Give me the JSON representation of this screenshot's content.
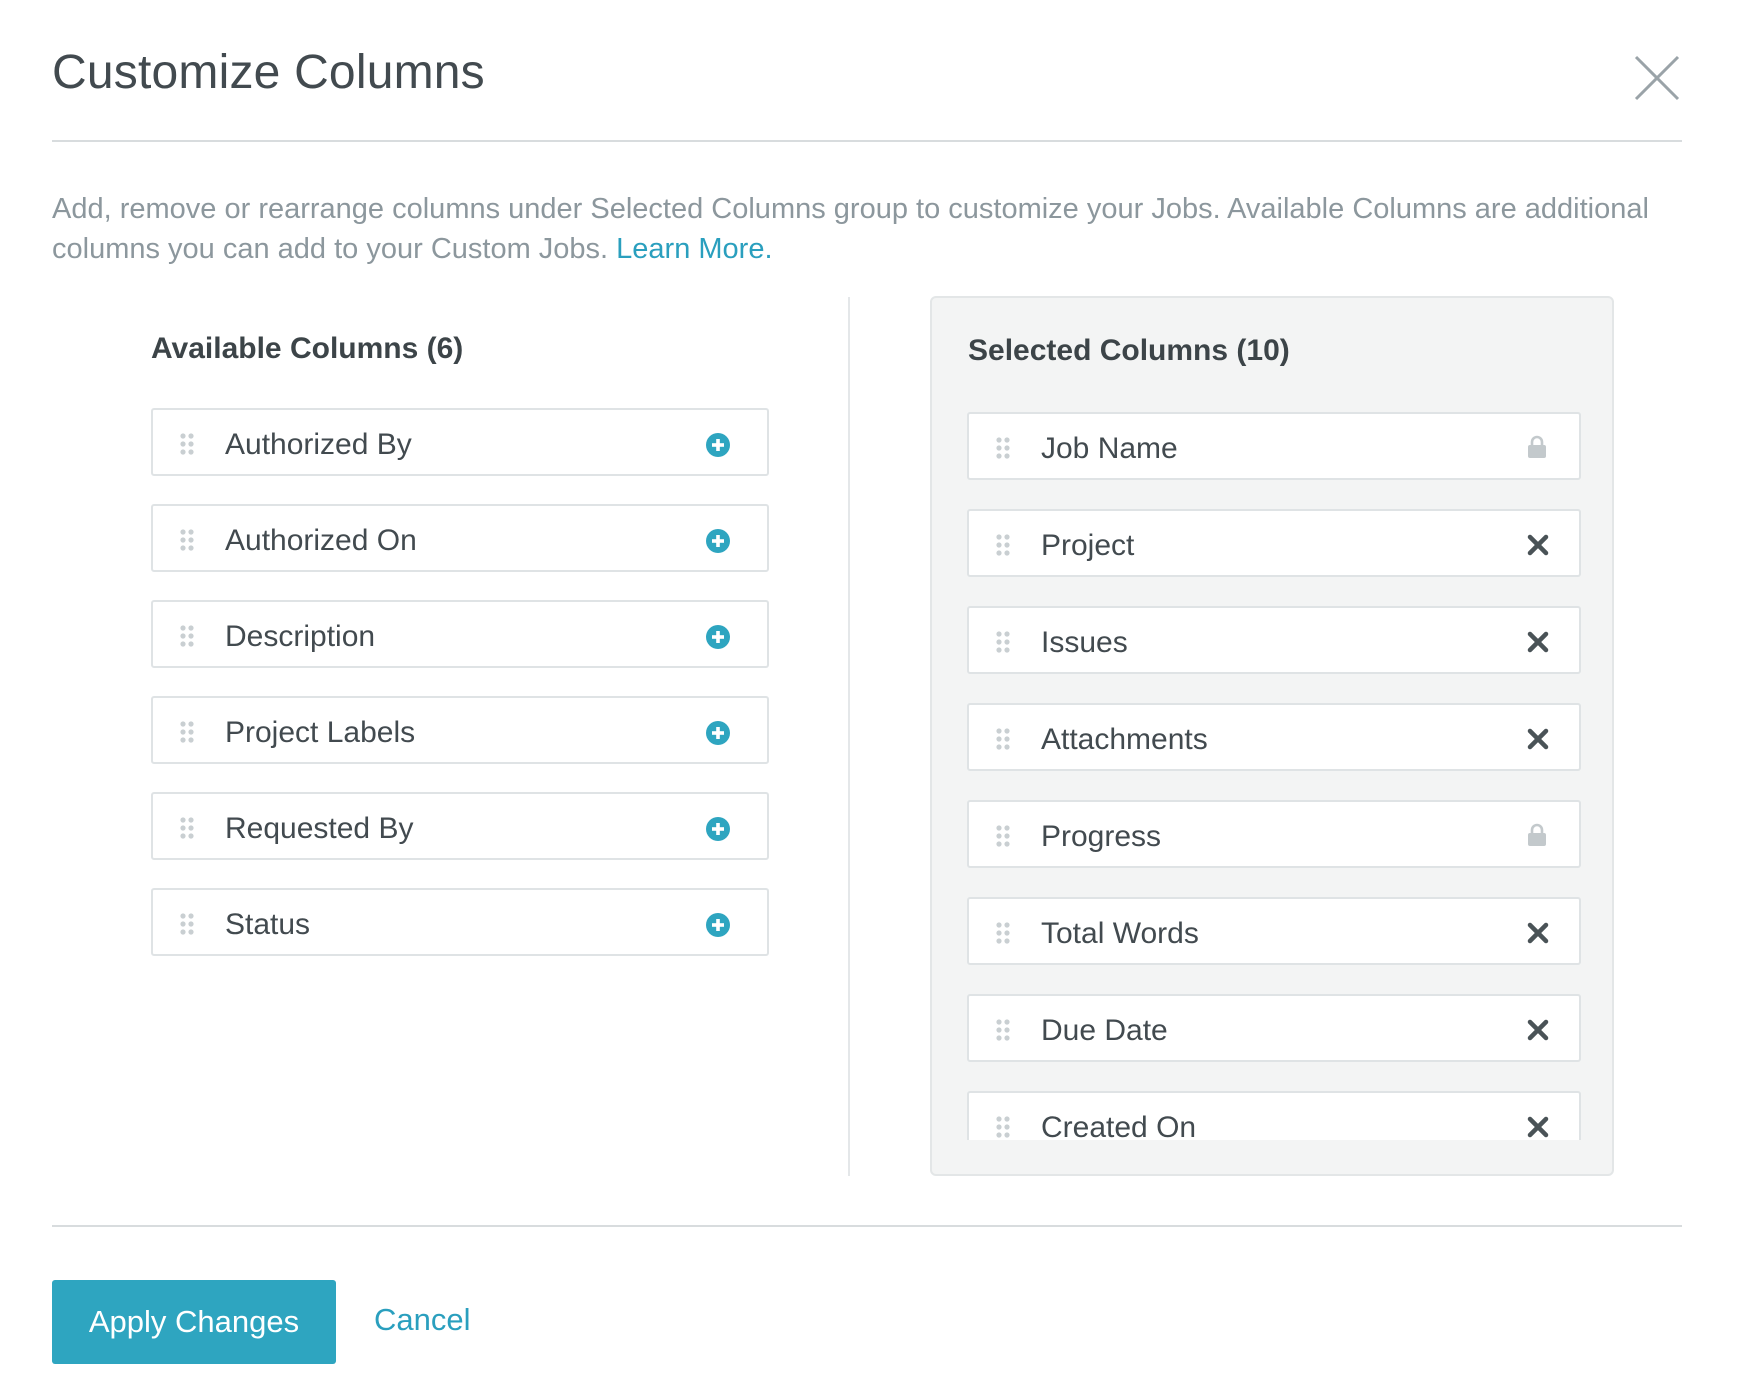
{
  "dialog": {
    "title": "Customize Columns",
    "description_text": "Add, remove or rearrange columns under Selected Columns group to customize your Jobs. Available Columns are additional columns you can add to your Custom Jobs. ",
    "learn_more_label": "Learn More.",
    "close_icon": "close-icon"
  },
  "available": {
    "heading": "Available Columns (6)",
    "items": [
      {
        "label": "Authorized By",
        "action_icon": "plus-circle-icon"
      },
      {
        "label": "Authorized On",
        "action_icon": "plus-circle-icon"
      },
      {
        "label": "Description",
        "action_icon": "plus-circle-icon"
      },
      {
        "label": "Project Labels",
        "action_icon": "plus-circle-icon"
      },
      {
        "label": "Requested By",
        "action_icon": "plus-circle-icon"
      },
      {
        "label": "Status",
        "action_icon": "plus-circle-icon"
      }
    ]
  },
  "selected": {
    "heading": "Selected Columns (10)",
    "items": [
      {
        "label": "Job Name",
        "action_icon": "lock-icon"
      },
      {
        "label": "Project",
        "action_icon": "remove-icon"
      },
      {
        "label": "Issues",
        "action_icon": "remove-icon"
      },
      {
        "label": "Attachments",
        "action_icon": "remove-icon"
      },
      {
        "label": "Progress",
        "action_icon": "lock-icon"
      },
      {
        "label": "Total Words",
        "action_icon": "remove-icon"
      },
      {
        "label": "Due Date",
        "action_icon": "remove-icon"
      },
      {
        "label": "Created On",
        "action_icon": "remove-icon"
      }
    ]
  },
  "footer": {
    "apply_label": "Apply Changes",
    "cancel_label": "Cancel"
  },
  "colors": {
    "accent": "#2ea5c0",
    "link": "#2a9fbe",
    "text": "#424a4f",
    "muted": "#8c979d",
    "panel_bg": "#f3f4f4"
  }
}
